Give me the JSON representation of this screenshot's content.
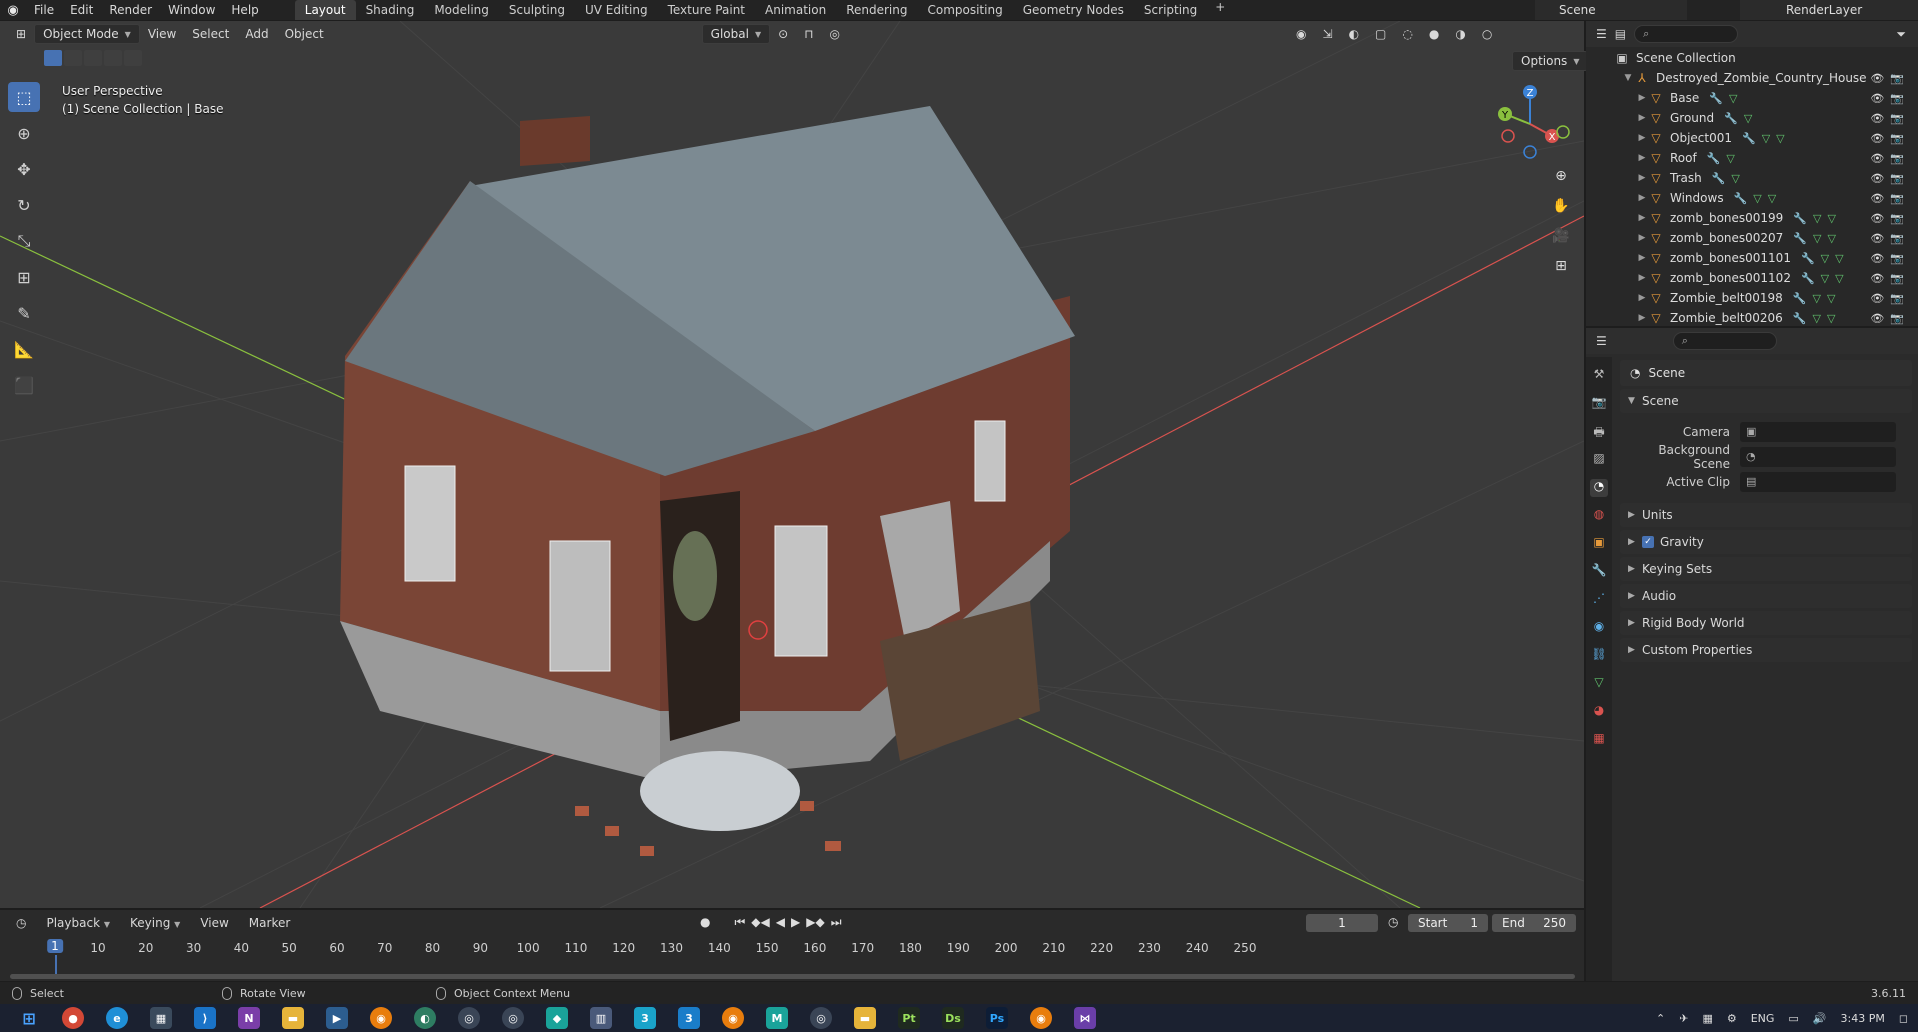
{
  "topbar": {
    "menus": [
      "File",
      "Edit",
      "Render",
      "Window",
      "Help"
    ],
    "workspaces": [
      "Layout",
      "Shading",
      "Modeling",
      "Sculpting",
      "UV Editing",
      "Texture Paint",
      "Animation",
      "Rendering",
      "Compositing",
      "Geometry Nodes",
      "Scripting"
    ],
    "active_workspace": "Layout",
    "scene": "Scene",
    "view_layer": "RenderLayer"
  },
  "viewport": {
    "mode": "Object Mode",
    "menus": [
      "View",
      "Select",
      "Add",
      "Object"
    ],
    "transform_orientation": "Global",
    "options_label": "Options",
    "overlay_line1": "User Perspective",
    "overlay_line2": "(1) Scene Collection | Base",
    "gizmo_axes": [
      "X",
      "Y",
      "Z"
    ],
    "colors": {
      "x_axis": "#d9534f",
      "y_axis": "#8ac03e",
      "z_axis": "#3b82d6",
      "selection": "#4772b3"
    }
  },
  "outliner": {
    "root": "Scene Collection",
    "collection": "Destroyed_Zombie_Country_House",
    "items": [
      "Base",
      "Ground",
      "Object001",
      "Roof",
      "Trash",
      "Windows",
      "zomb_bones00199",
      "zomb_bones00207",
      "zomb_bones001101",
      "zomb_bones001102",
      "Zombie_belt00198",
      "Zombie_belt00206"
    ]
  },
  "properties": {
    "context": "Scene",
    "panel_title": "Scene",
    "fields": [
      {
        "label": "Camera",
        "value": ""
      },
      {
        "label": "Background Scene",
        "value": ""
      },
      {
        "label": "Active Clip",
        "value": ""
      }
    ],
    "sections": [
      "Units",
      "Gravity",
      "Keying Sets",
      "Audio",
      "Rigid Body World",
      "Custom Properties"
    ],
    "gravity_enabled": true
  },
  "timeline": {
    "menus": [
      "Playback",
      "Keying",
      "View",
      "Marker"
    ],
    "current_frame": "1",
    "start_label": "Start",
    "start": "1",
    "end_label": "End",
    "end": "250",
    "ruler": [
      "1",
      "10",
      "20",
      "30",
      "40",
      "50",
      "60",
      "70",
      "80",
      "90",
      "100",
      "110",
      "120",
      "130",
      "140",
      "150",
      "160",
      "170",
      "180",
      "190",
      "200",
      "210",
      "220",
      "230",
      "240",
      "250"
    ]
  },
  "statusbar": {
    "left": "Select",
    "middle": "Rotate View",
    "right": "Object Context Menu",
    "version": "3.6.11"
  },
  "taskbar": {
    "language": "ENG",
    "time": "3:43 PM"
  }
}
